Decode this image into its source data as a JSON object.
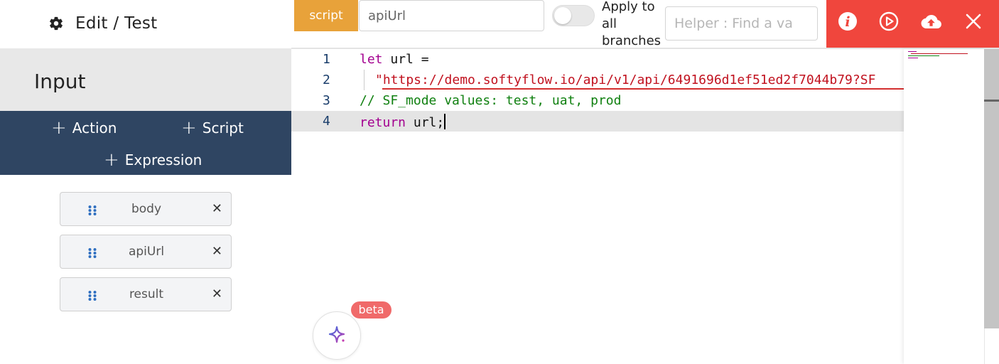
{
  "header": {
    "title": "Edit / Test",
    "type_tag": "script",
    "name_value": "apiUrl",
    "apply_label": "Apply to all branches",
    "helper_placeholder": "Helper : Find a va",
    "action_icons": [
      "info-icon",
      "play-icon",
      "cloud-upload-icon",
      "close-icon"
    ]
  },
  "sidebar": {
    "title": "Input",
    "add_action": "Action",
    "add_script": "Script",
    "add_expression": "Expression",
    "items": [
      {
        "label": "body"
      },
      {
        "label": "apiUrl"
      },
      {
        "label": "result"
      }
    ]
  },
  "editor": {
    "lines": [
      {
        "number": "1",
        "tokens": [
          {
            "t": "let",
            "c": "kw"
          },
          {
            "t": " url =",
            "c": "plain"
          }
        ]
      },
      {
        "number": "2",
        "tokens": [
          {
            "t": "\"https://demo.softyflow.io/api/v1/api/6491696d1ef51ed2f7044b79?SF",
            "c": "str"
          }
        ]
      },
      {
        "number": "3",
        "tokens": [
          {
            "t": "// SF_mode values: test, uat, prod",
            "c": "cmt"
          }
        ]
      },
      {
        "number": "4",
        "tokens": [
          {
            "t": "return",
            "c": "kw"
          },
          {
            "t": " url;",
            "c": "plain"
          }
        ]
      }
    ]
  },
  "ai": {
    "badge": "beta"
  },
  "colors": {
    "script_tag": "#e8a23a",
    "action_bar": "#f0463d",
    "add_bar": "#2f4562"
  }
}
